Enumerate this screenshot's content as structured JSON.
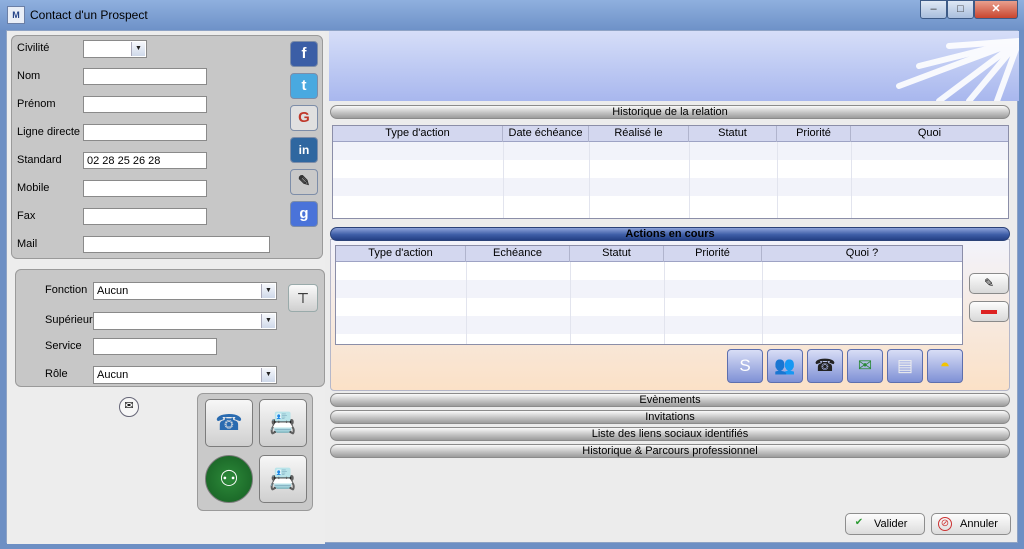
{
  "window": {
    "title": "Contact d'un Prospect",
    "app_icon": "M",
    "min": "–",
    "max": "□",
    "close": "✕"
  },
  "identity": {
    "labels": {
      "civilite": "Civilité",
      "nom": "Nom",
      "prenom": "Prénom",
      "ligne_directe": "Ligne directe",
      "standard": "Standard",
      "mobile": "Mobile",
      "fax": "Fax",
      "mail": "Mail"
    },
    "values": {
      "civilite": "",
      "nom": "",
      "prenom": "",
      "ligne_directe": "",
      "standard": "02 28 25 26 28",
      "mobile": "",
      "fax": "",
      "mail": ""
    }
  },
  "social": [
    {
      "name": "facebook",
      "glyph": "f",
      "color": "#3b5ea6"
    },
    {
      "name": "twitter",
      "glyph": "t",
      "color": "#49a9e0"
    },
    {
      "name": "viadeo",
      "glyph": "G",
      "color": "#e0e0e0"
    },
    {
      "name": "linkedin",
      "glyph": "in",
      "color": "#2f67a0"
    },
    {
      "name": "other",
      "glyph": "✎",
      "color": "#c9c9c9"
    },
    {
      "name": "google",
      "glyph": "g",
      "color": "#4a73d9"
    }
  ],
  "role": {
    "labels": {
      "fonction": "Fonction",
      "superieur": "Supérieur",
      "service": "Service",
      "role": "Rôle"
    },
    "values": {
      "fonction": "Aucun",
      "superieur": "",
      "service": "",
      "role": "Aucun"
    }
  },
  "sections": {
    "historique": "Historique de la relation",
    "actions": "Actions en cours",
    "evenements": "Evènements",
    "invitations": "Invitations",
    "liens": "Liste des liens sociaux identifiés",
    "parcours": "Historique & Parcours professionnel"
  },
  "historique_columns": [
    "Type d'action",
    "Date échéance",
    "Réalisé le",
    "Statut",
    "Priorité",
    "Quoi"
  ],
  "actions_columns": [
    "Type d'action",
    "Echéance",
    "Statut",
    "Priorité",
    "Quoi ?"
  ],
  "buttons": {
    "valider": "Valider",
    "annuler": "Annuler"
  }
}
